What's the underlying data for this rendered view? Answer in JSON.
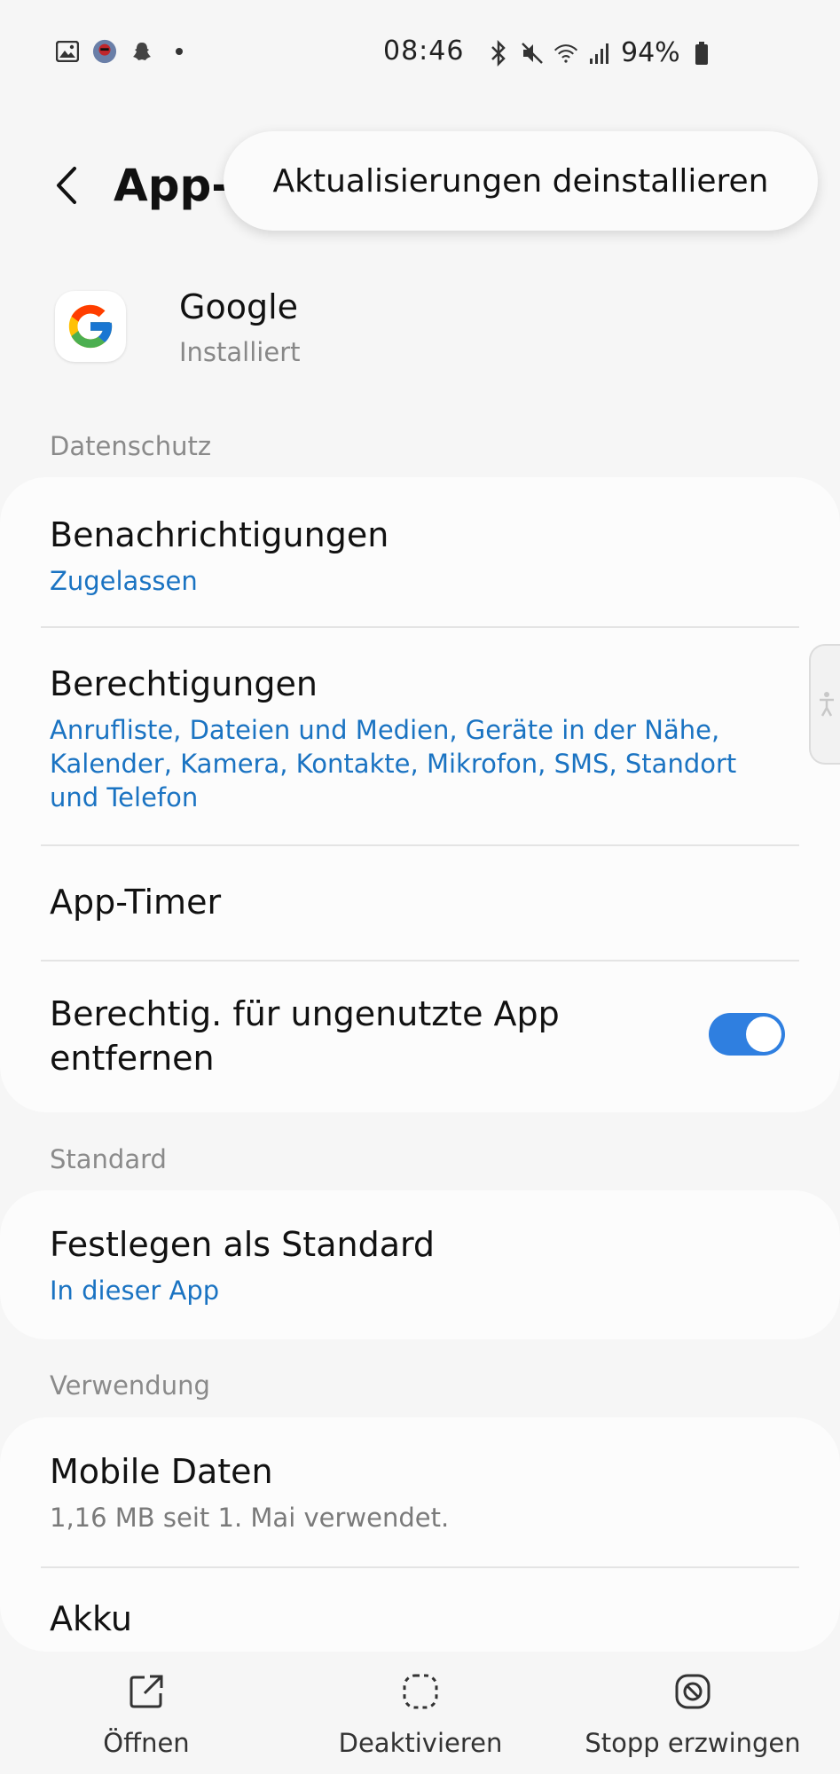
{
  "status_bar": {
    "time": "08:46",
    "battery": "94%",
    "left_icons": [
      "gallery-icon",
      "avatar-icon",
      "snapchat-icon",
      "dot-icon"
    ],
    "right_icons": [
      "bluetooth-icon",
      "mute-icon",
      "wifi-icon",
      "signal-icon",
      "battery-icon"
    ]
  },
  "app_bar": {
    "title": "App-I",
    "back_icon": "back-arrow-icon"
  },
  "popup_menu": {
    "item": "Aktualisierungen deinstallieren"
  },
  "app": {
    "name": "Google",
    "status": "Installiert",
    "icon": "google-g-icon"
  },
  "sections": {
    "privacy": {
      "title": "Datenschutz",
      "notifications": {
        "title": "Benachrichtigungen",
        "value": "Zugelassen"
      },
      "permissions": {
        "title": "Berechtigungen",
        "value": "Anrufliste, Dateien und Medien, Geräte in der Nähe, Kalender, Kamera, Kontakte, Mikrofon, SMS, Standort und Telefon"
      },
      "app_timer": {
        "title": "App-Timer"
      },
      "remove_permissions": {
        "title": "Berechtig. für ungenutzte App entfernen",
        "toggle_on": true
      }
    },
    "default": {
      "title": "Standard",
      "set_default": {
        "title": "Festlegen als Standard",
        "value": "In dieser App"
      }
    },
    "usage": {
      "title": "Verwendung",
      "mobile_data": {
        "title": "Mobile Daten",
        "value": "1,16 MB seit 1. Mai verwendet."
      },
      "battery": {
        "title": "Akku"
      }
    }
  },
  "bottom_bar": {
    "open": "Öffnen",
    "disable": "Deaktivieren",
    "force_stop": "Stopp erzwingen"
  },
  "colors": {
    "accent_blue": "#1a73c2",
    "toggle_blue": "#2f7fe0",
    "background": "#f6f6f6",
    "card": "#fcfcfc"
  }
}
